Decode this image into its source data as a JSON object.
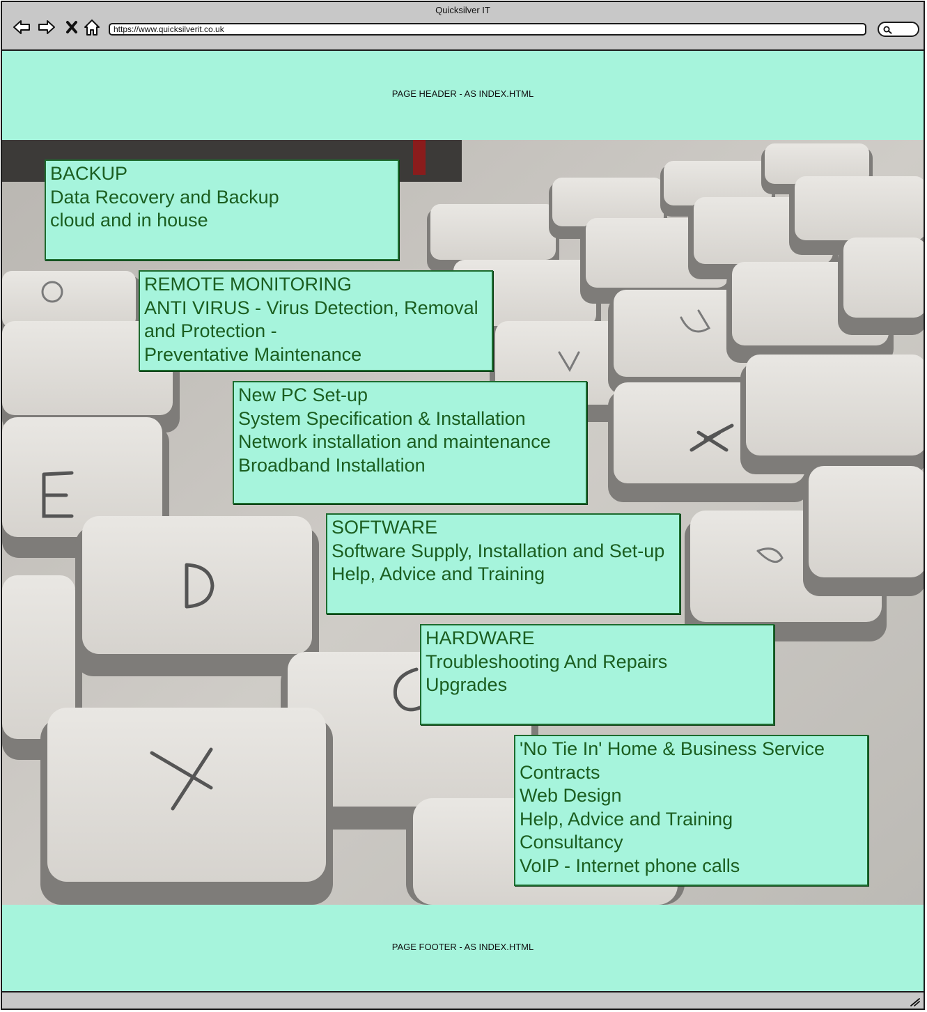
{
  "window": {
    "title": "Quicksilver IT"
  },
  "browser": {
    "url": "https://www.quicksilverit.co.uk",
    "icons": [
      "back-arrow-icon",
      "forward-arrow-icon",
      "stop-icon",
      "home-icon",
      "search-icon"
    ]
  },
  "header": {
    "text": "PAGE HEADER - AS INDEX.HTML"
  },
  "footer": {
    "text": "PAGE FOOTER - AS INDEX.HTML"
  },
  "services": [
    {
      "lines": [
        "BACKUP",
        "Data Recovery and Backup",
        "cloud and in house"
      ]
    },
    {
      "lines": [
        "REMOTE MONITORING",
        "ANTI VIRUS - Virus Detection, Removal",
        "and Protection -",
        "Preventative Maintenance"
      ]
    },
    {
      "lines": [
        "New PC Set-up",
        "System Specification & Installation",
        "Network installation and maintenance",
        "Broadband Installation"
      ]
    },
    {
      "lines": [
        "SOFTWARE",
        "Software Supply, Installation and Set-up",
        "Help, Advice and Training"
      ]
    },
    {
      "lines": [
        "HARDWARE",
        "Troubleshooting And Repairs",
        "Upgrades"
      ]
    },
    {
      "lines": [
        "'No Tie In' Home & Business Service",
        "Contracts",
        "Web Design",
        "Help, Advice and Training",
        "Consultancy",
        "VoIP - Internet phone calls"
      ]
    }
  ],
  "colors": {
    "band_background": "#a6f4dc",
    "card_text": "#1b5e20",
    "card_border": "#1c6b2e",
    "chrome": "#c8c8c8"
  }
}
